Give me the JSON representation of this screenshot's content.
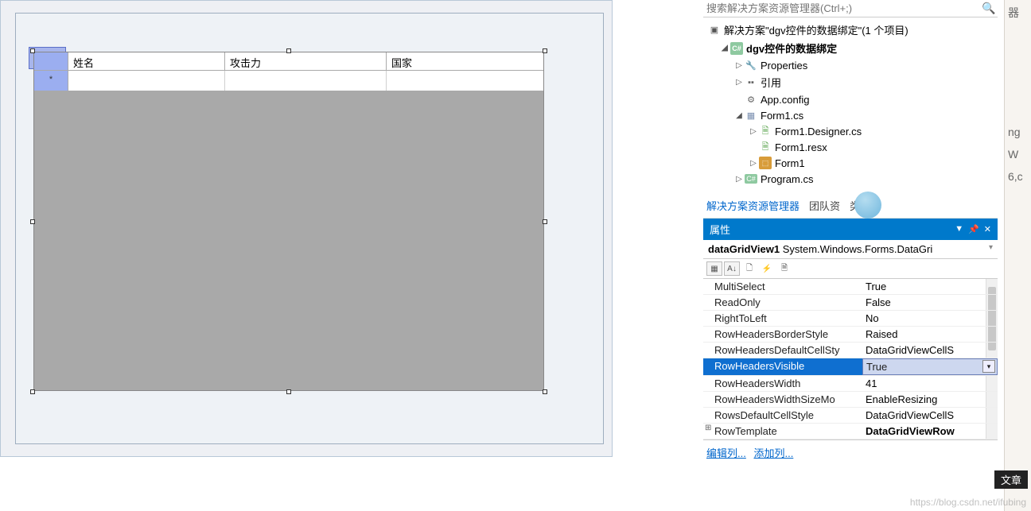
{
  "grid": {
    "columns": [
      "姓名",
      "攻击力",
      "国家"
    ],
    "newrow_marker": "*"
  },
  "solution_explorer": {
    "search_placeholder": "搜索解决方案资源管理器(Ctrl+;)",
    "solution_label": "解决方案\"dgv控件的数据绑定\"(1 个项目)",
    "project": "dgv控件的数据绑定",
    "nodes": {
      "properties": "Properties",
      "references": "引用",
      "appconfig": "App.config",
      "form1": "Form1.cs",
      "form1_designer": "Form1.Designer.cs",
      "form1_resx": "Form1.resx",
      "form1_class": "Form1",
      "program": "Program.cs"
    }
  },
  "tabs": {
    "t1": "解决方案资源管理器",
    "t2": "团队资",
    "t3": "类视图"
  },
  "properties": {
    "title": "属性",
    "object_name": "dataGridView1",
    "object_type": "System.Windows.Forms.DataGri",
    "rows": [
      {
        "name": "MultiSelect",
        "value": "True"
      },
      {
        "name": "ReadOnly",
        "value": "False"
      },
      {
        "name": "RightToLeft",
        "value": "No"
      },
      {
        "name": "RowHeadersBorderStyle",
        "value": "Raised"
      },
      {
        "name": "RowHeadersDefaultCellSty",
        "value": "DataGridViewCellS"
      },
      {
        "name": "RowHeadersVisible",
        "value": "True",
        "selected": true,
        "dropdown": true
      },
      {
        "name": "RowHeadersWidth",
        "value": "41"
      },
      {
        "name": "RowHeadersWidthSizeMo",
        "value": "EnableResizing"
      },
      {
        "name": "RowsDefaultCellStyle",
        "value": "DataGridViewCellS"
      },
      {
        "name": "RowTemplate",
        "value": "DataGridViewRow",
        "bold": true,
        "expander": "⊞"
      }
    ],
    "links": {
      "edit": "编辑列...",
      "add": "添加列..."
    }
  },
  "far_right": {
    "l1": "器",
    "l2": "ng",
    "l3": "W",
    "l4": "6,c"
  },
  "black_tag": "文章",
  "watermark": "https://blog.csdn.net/ifubing"
}
